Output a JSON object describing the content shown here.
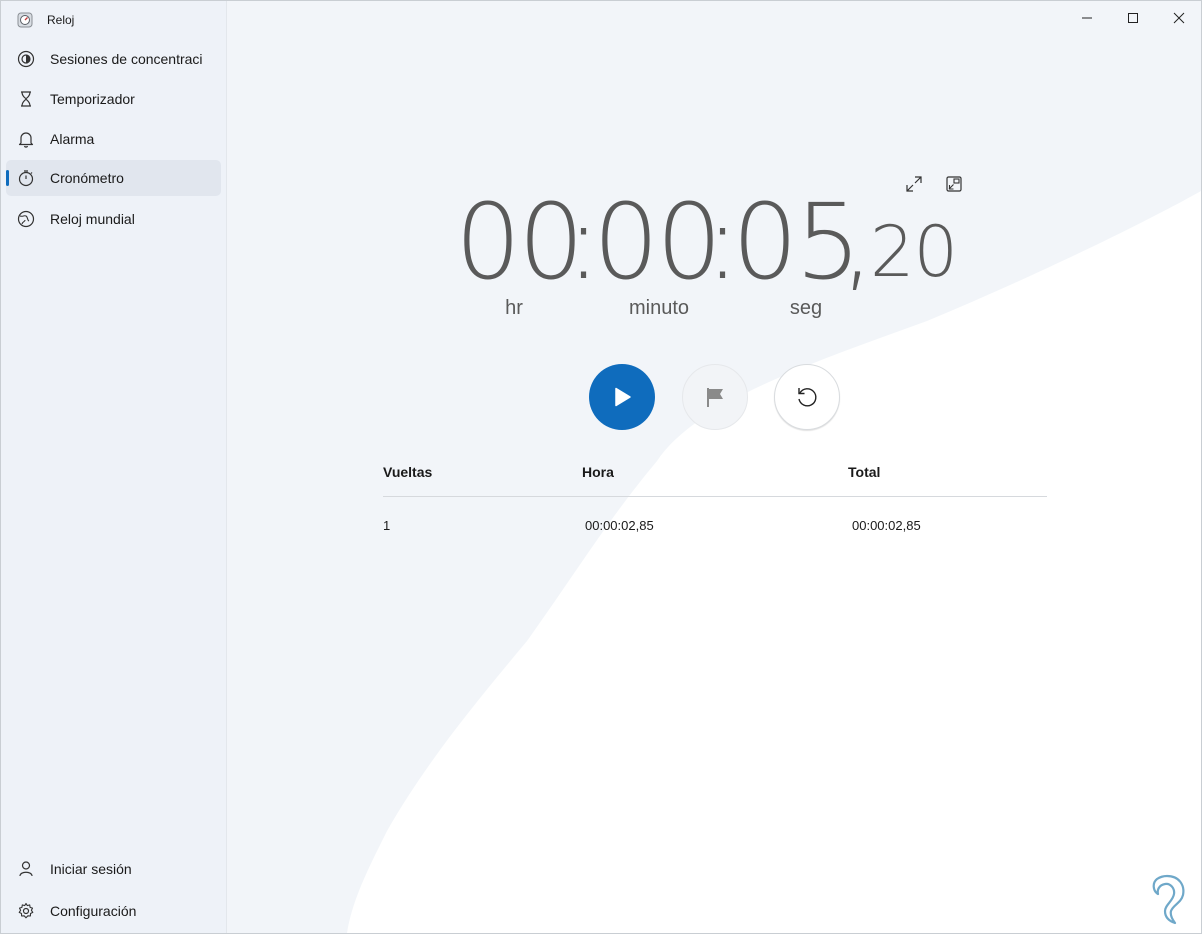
{
  "app": {
    "title": "Reloj"
  },
  "sidebar": {
    "items": [
      {
        "label": "Sesiones de concentración",
        "icon": "focus-icon"
      },
      {
        "label": "Temporizador",
        "icon": "hourglass-icon"
      },
      {
        "label": "Alarma",
        "icon": "bell-icon"
      },
      {
        "label": "Cronómetro",
        "icon": "stopwatch-icon",
        "selected": true
      },
      {
        "label": "Reloj mundial",
        "icon": "globe-icon"
      }
    ],
    "bottom": [
      {
        "label": "Iniciar sesión",
        "icon": "person-icon"
      },
      {
        "label": "Configuración",
        "icon": "gear-icon"
      }
    ]
  },
  "stopwatch": {
    "hours": "00",
    "minutes": "00",
    "seconds": "05",
    "separator": ":",
    "decimal_separator": ",",
    "hundredths": "20",
    "units": {
      "hours": "hr",
      "minutes": "minuto",
      "seconds": "seg"
    },
    "state": "paused"
  },
  "laps": {
    "headers": {
      "lap": "Vueltas",
      "time": "Hora",
      "total": "Total"
    },
    "rows": [
      {
        "lap": "1",
        "time": "00:00:02,85",
        "total": "00:00:02,85"
      }
    ]
  },
  "colors": {
    "accent": "#0f6cbd",
    "sidebar_bg": "#eef2f8",
    "text": "#5a5a5a"
  }
}
